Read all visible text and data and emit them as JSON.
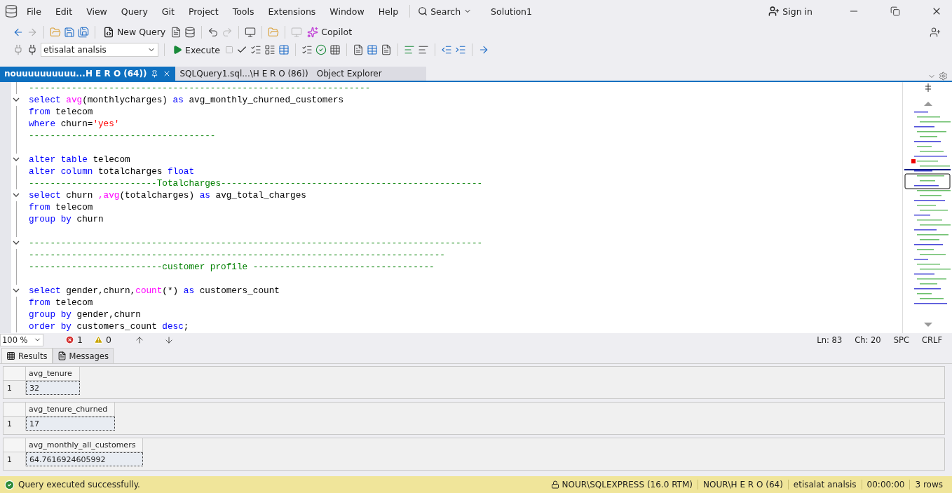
{
  "menu": [
    "File",
    "Edit",
    "View",
    "Query",
    "Git",
    "Project",
    "Tools",
    "Extensions",
    "Window",
    "Help"
  ],
  "search": {
    "label": "Search"
  },
  "solution": "Solution1",
  "sign_in": "Sign in",
  "toolbar": {
    "new_query": "New Query",
    "copilot": "Copilot",
    "database": "etisalat analsis",
    "execute": "Execute"
  },
  "tabs": [
    {
      "label": "nouuuuuuuuuu...H E R O (64))",
      "selected": true
    },
    {
      "label": "SQLQuery1.sql...\\H E R O (86))",
      "selected": false
    },
    {
      "label": "Object Explorer",
      "selected": false
    }
  ],
  "editor": {
    "lines": [
      {
        "fold": false,
        "tokens": [
          {
            "kind": "comment",
            "text": "----------------------------------------------------------------"
          }
        ]
      },
      {
        "fold": true,
        "tokens": [
          {
            "kind": "keyword",
            "text": "select "
          },
          {
            "kind": "function",
            "text": "avg"
          },
          {
            "kind": "plain",
            "text": "(monthlycharges) "
          },
          {
            "kind": "keyword",
            "text": "as"
          },
          {
            "kind": "plain",
            "text": " avg_monthly_churned_customers"
          }
        ]
      },
      {
        "fold": false,
        "tokens": [
          {
            "kind": "keyword",
            "text": "from"
          },
          {
            "kind": "plain",
            "text": " telecom"
          }
        ]
      },
      {
        "fold": false,
        "tokens": [
          {
            "kind": "keyword",
            "text": "where"
          },
          {
            "kind": "plain",
            "text": " churn="
          },
          {
            "kind": "string",
            "text": "'yes'"
          }
        ]
      },
      {
        "fold": false,
        "tokens": [
          {
            "kind": "comment",
            "text": "-----------------------------------"
          }
        ]
      },
      {
        "fold": false
      },
      {
        "fold": true,
        "tokens": [
          {
            "kind": "keyword",
            "text": "alter table"
          },
          {
            "kind": "plain",
            "text": " telecom"
          }
        ]
      },
      {
        "fold": false,
        "tokens": [
          {
            "kind": "keyword",
            "text": "alter column"
          },
          {
            "kind": "plain",
            "text": " totalcharges "
          },
          {
            "kind": "keyword",
            "text": "float"
          }
        ]
      },
      {
        "fold": false,
        "tokens": [
          {
            "kind": "comment",
            "text": "------------------------Totalcharges-------------------------------------------------"
          }
        ]
      },
      {
        "fold": true,
        "tokens": [
          {
            "kind": "keyword",
            "text": "select"
          },
          {
            "kind": "plain",
            "text": " churn "
          },
          {
            "kind": "function",
            "text": ",avg"
          },
          {
            "kind": "plain",
            "text": "(totalcharges) "
          },
          {
            "kind": "keyword",
            "text": "as"
          },
          {
            "kind": "plain",
            "text": " avg_total_charges"
          }
        ]
      },
      {
        "fold": false,
        "tokens": [
          {
            "kind": "keyword",
            "text": "from"
          },
          {
            "kind": "plain",
            "text": " telecom"
          }
        ]
      },
      {
        "fold": false,
        "tokens": [
          {
            "kind": "keyword",
            "text": "group by"
          },
          {
            "kind": "plain",
            "text": " churn"
          }
        ]
      },
      {
        "fold": false
      },
      {
        "fold": true,
        "tokens": [
          {
            "kind": "comment",
            "text": "-------------------------------------------------------------------------------------"
          }
        ]
      },
      {
        "fold": false,
        "tokens": [
          {
            "kind": "comment",
            "text": "------------------------------------------------------------------------------"
          }
        ]
      },
      {
        "fold": false,
        "tokens": [
          {
            "kind": "comment",
            "text": "-------------------------customer profile ----------------------------------"
          }
        ]
      },
      {
        "fold": false
      },
      {
        "fold": true,
        "tokens": [
          {
            "kind": "keyword",
            "text": "select"
          },
          {
            "kind": "plain",
            "text": " gender,churn,"
          },
          {
            "kind": "function",
            "text": "count"
          },
          {
            "kind": "plain",
            "text": "(*) "
          },
          {
            "kind": "keyword",
            "text": "as"
          },
          {
            "kind": "plain",
            "text": " customers_count"
          }
        ]
      },
      {
        "fold": false,
        "tokens": [
          {
            "kind": "keyword",
            "text": "from"
          },
          {
            "kind": "plain",
            "text": " telecom"
          }
        ]
      },
      {
        "fold": false,
        "tokens": [
          {
            "kind": "keyword",
            "text": "group by"
          },
          {
            "kind": "plain",
            "text": " gender,churn"
          }
        ]
      },
      {
        "fold": false,
        "tokens": [
          {
            "kind": "keyword",
            "text": "order by"
          },
          {
            "kind": "plain",
            "text": " customers_count "
          },
          {
            "kind": "keyword",
            "text": "desc"
          },
          {
            "kind": "plain",
            "text": ";"
          }
        ]
      }
    ]
  },
  "editor_status": {
    "zoom": "100 %",
    "errors": "1",
    "warnings": "0",
    "line": "Ln: 83",
    "column": "Ch: 20",
    "spacing": "SPC",
    "line_ending": "CRLF"
  },
  "result_tabs": [
    {
      "label": "Results",
      "selected": true
    },
    {
      "label": "Messages",
      "selected": false
    }
  ],
  "grids": [
    {
      "column": "avg_tenure",
      "row_number": "1",
      "value": "32"
    },
    {
      "column": "avg_tenure_churned",
      "row_number": "1",
      "value": "17"
    },
    {
      "column": "avg_monthly_all_customers",
      "row_number": "1",
      "value": "64.7616924605992"
    }
  ],
  "status_bar": {
    "message": "Query executed successfully.",
    "server": "NOUR\\SQLEXPRESS (16.0 RTM)",
    "user": "NOUR\\H E R O (64)",
    "database": "etisalat analsis",
    "elapsed": "00:00:00",
    "rows": "3 rows"
  }
}
